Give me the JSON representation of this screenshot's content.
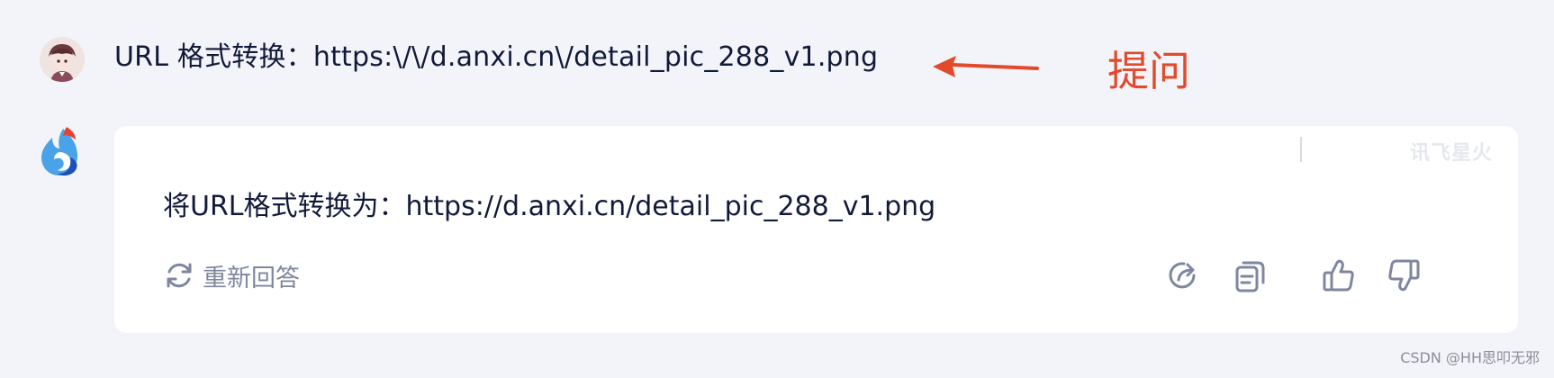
{
  "user_message": {
    "text": "URL 格式转换：https:\\/\\/d.anxi.cn\\/detail_pic_288_v1.png"
  },
  "annotation": {
    "label": "提问",
    "color": "#e24a2b"
  },
  "assistant_message": {
    "watermark": "讯飞星火",
    "text": "将URL格式转换为：https://d.anxi.cn/detail_pic_288_v1.png",
    "regenerate_label": "重新回答",
    "actions": [
      {
        "name": "share-icon"
      },
      {
        "name": "copy-icon"
      },
      {
        "name": "thumbs-up-icon"
      },
      {
        "name": "thumbs-down-icon"
      }
    ]
  },
  "footer": {
    "credit": "CSDN @HH思叩无邪"
  },
  "colors": {
    "background": "#f3f4f9",
    "card": "#ffffff",
    "text": "#121a3a",
    "muted": "#7f869f"
  }
}
